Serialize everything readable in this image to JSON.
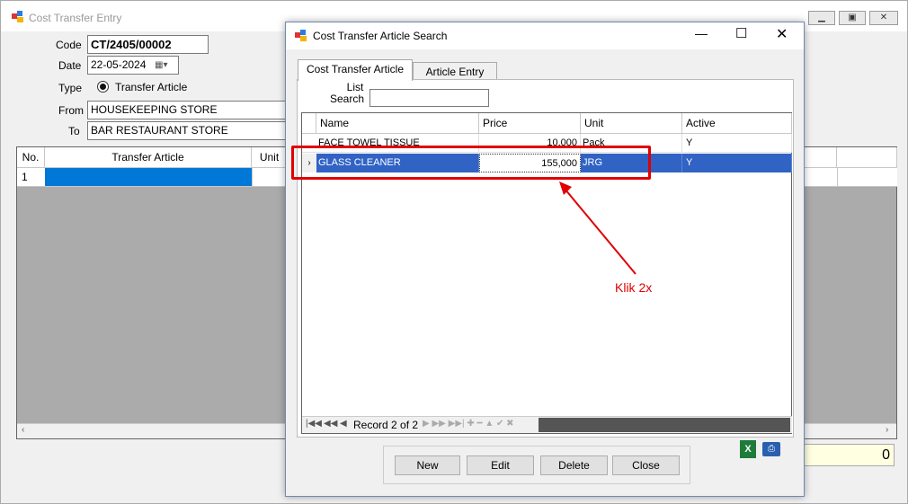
{
  "main": {
    "title": "Cost Transfer Entry",
    "code_label": "Code",
    "code_value": "CT/2405/00002",
    "date_label": "Date",
    "date_value": "22-05-2024",
    "type_label": "Type",
    "type_option": "Transfer Article",
    "from_label": "From",
    "from_value": "HOUSEKEEPING STORE",
    "to_label": "To",
    "to_value": "BAR RESTAURANT STORE",
    "grid": {
      "columns": [
        "No.",
        "Transfer Article",
        "Unit"
      ],
      "rows": [
        {
          "no": "1"
        }
      ]
    },
    "total_value": "0"
  },
  "dialog": {
    "title": "Cost Transfer Article Search",
    "tabs": [
      "Cost Transfer Article List",
      "Article Entry"
    ],
    "search_label": "Search",
    "search_value": "",
    "columns": [
      "Name",
      "Price",
      "Unit",
      "Active"
    ],
    "rows": [
      {
        "name": "FACE TOWEL TISSUE",
        "price": "10,000",
        "unit": "Pack",
        "active": "Y"
      },
      {
        "name": "GLASS CLEANER",
        "price": "155,000",
        "unit": "JRG",
        "active": "Y"
      }
    ],
    "navigator_text": "Record 2 of 2",
    "buttons": {
      "new": "New",
      "edit": "Edit",
      "delete": "Delete",
      "close": "Close"
    }
  },
  "annotation": {
    "text": "Klik 2x",
    "color": "#e00000"
  },
  "colors": {
    "selection": "#0078d7",
    "highlight_row": "#3163c5",
    "total_bg": "#ffffe1"
  }
}
